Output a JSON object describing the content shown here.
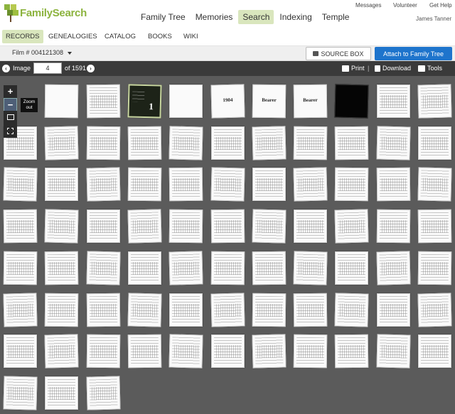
{
  "brand": {
    "name": "FamilySearch",
    "color": "#8cb33e"
  },
  "main_nav": [
    "Family Tree",
    "Memories",
    "Search",
    "Indexing",
    "Temple"
  ],
  "main_nav_active": "Search",
  "util_nav": {
    "messages": "Messages",
    "volunteer": "Volunteer",
    "help": "Get Help",
    "user": "James Tanner"
  },
  "sec_nav": [
    "RECORDS",
    "GENEALOGIES",
    "CATALOG",
    "BOOKS",
    "WIKI"
  ],
  "sec_nav_active": "RECORDS",
  "film": {
    "label": "Film # 004121308"
  },
  "buttons": {
    "source_box": "SOURCE BOX",
    "attach": "Attach to Family Tree"
  },
  "viewer": {
    "image_label": "Image",
    "image_value": "4",
    "of_label": "of 1591",
    "print": "Print",
    "download": "Download",
    "tools": "Tools",
    "separator": "|"
  },
  "zoom": {
    "plus": "+",
    "minus": "−",
    "tooltip_line1": "Zoom",
    "tooltip_line2": "out"
  },
  "thumbnail_captions": {
    "t7": "1904",
    "t8": "Bearer",
    "t9": "Bearer",
    "t5_number": "1"
  },
  "colors": {
    "accent_green": "#d9e6bd",
    "attach_blue": "#1e74cc",
    "viewer_bg": "#5b5b5b",
    "toolbar_bg": "#3a3a3a"
  },
  "gallery": {
    "rows": 8,
    "columns": 11,
    "last_row_count": 3
  }
}
